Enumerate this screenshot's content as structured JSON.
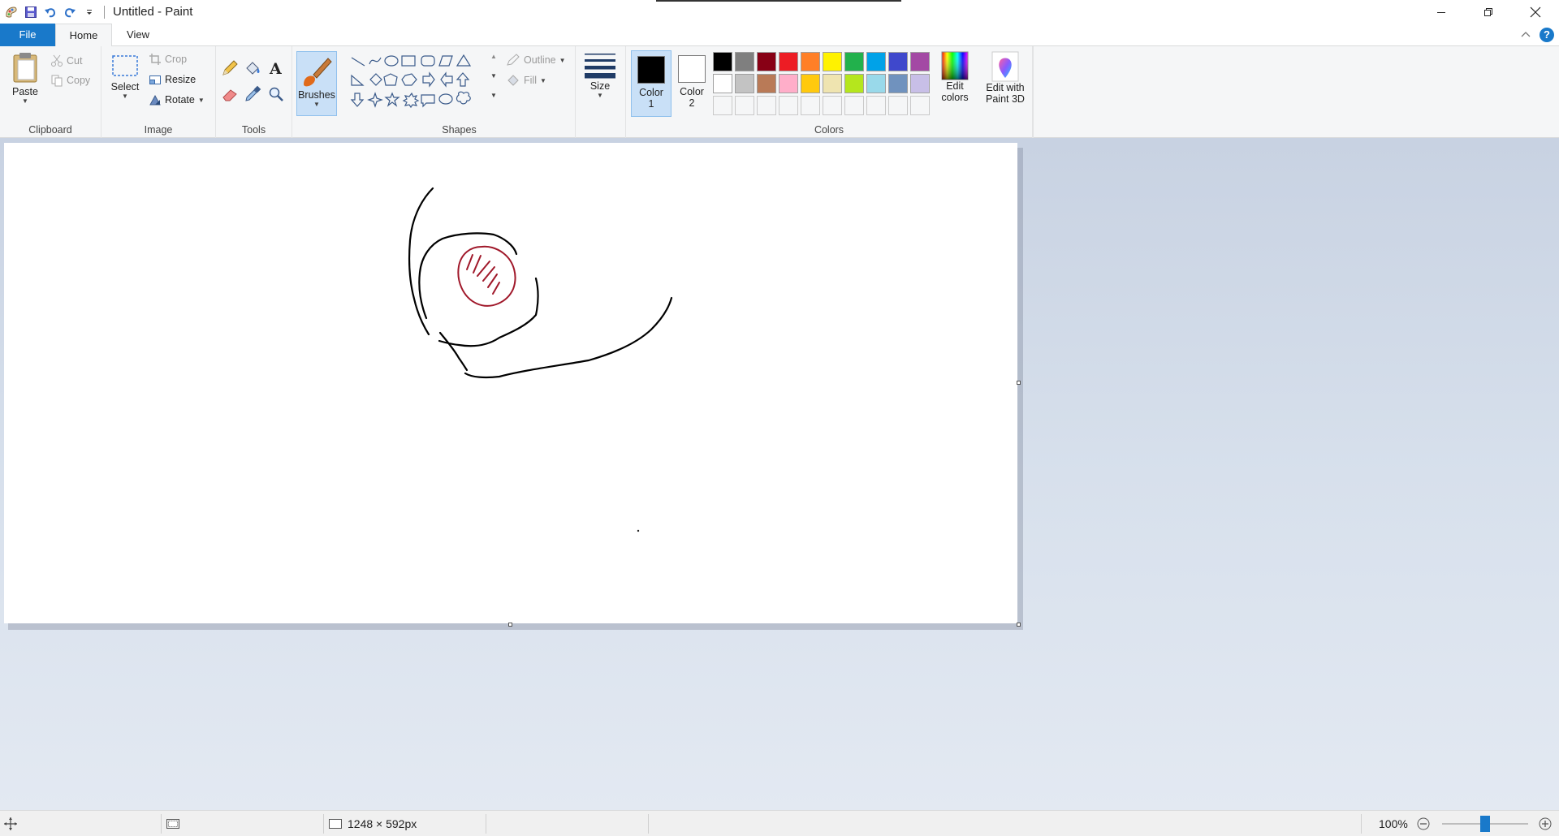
{
  "window": {
    "title": "Untitled - Paint"
  },
  "tabs": [
    {
      "label": "File"
    },
    {
      "label": "Home"
    },
    {
      "label": "View"
    }
  ],
  "clipboard": {
    "paste": "Paste",
    "cut": "Cut",
    "copy": "Copy",
    "group": "Clipboard"
  },
  "image": {
    "select": "Select",
    "crop": "Crop",
    "resize": "Resize",
    "rotate": "Rotate",
    "group": "Image"
  },
  "tools": {
    "group": "Tools"
  },
  "brushes": {
    "label": "Brushes"
  },
  "shapes": {
    "outline": "Outline",
    "fill": "Fill",
    "group": "Shapes"
  },
  "size": {
    "label": "Size"
  },
  "colors": {
    "color1": "Color",
    "color1_num": "1",
    "color2": "Color",
    "color2_num": "2",
    "color1_value": "#000000",
    "color2_value": "#ffffff",
    "edit_colors_1": "Edit",
    "edit_colors_2": "colors",
    "group": "Colors",
    "palette": [
      "#000000",
      "#7f7f7f",
      "#880015",
      "#ed1c24",
      "#ff7f27",
      "#fff200",
      "#22b14c",
      "#00a2e8",
      "#3f48cc",
      "#a349a4",
      "#ffffff",
      "#c3c3c3",
      "#b97a57",
      "#ffaec9",
      "#ffc90e",
      "#efe4b0",
      "#b5e61d",
      "#99d9ea",
      "#7092be",
      "#c8bfe7"
    ]
  },
  "paint3d": {
    "line1": "Edit with",
    "line2": "Paint 3D"
  },
  "status": {
    "dimensions": "1248 × 592px",
    "zoom": "100%"
  }
}
